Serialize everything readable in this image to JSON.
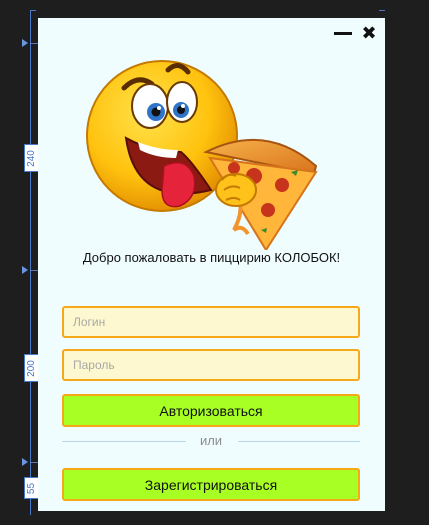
{
  "window": {
    "minimize_icon": "minimize-icon",
    "close_icon": "close-icon",
    "close_glyph": "✖"
  },
  "mascot": {
    "icon": "smiley-pizza-icon"
  },
  "welcome_text": "Добро пожаловать в пиццирию КОЛОБОК!",
  "form": {
    "login_placeholder": "Логин",
    "password_placeholder": "Пароль",
    "login_value": "",
    "password_value": "",
    "authorize_label": "Авторизоваться",
    "or_label": "или",
    "register_label": "Зарегистрироваться"
  },
  "designer": {
    "height_labels": [
      "240",
      "200",
      "55"
    ]
  },
  "colors": {
    "window_bg": "#f0fdff",
    "field_bg": "#fdf8cf",
    "accent_border": "#f6a818",
    "button_bg": "#a7ff24",
    "guide": "#4a78c9"
  }
}
